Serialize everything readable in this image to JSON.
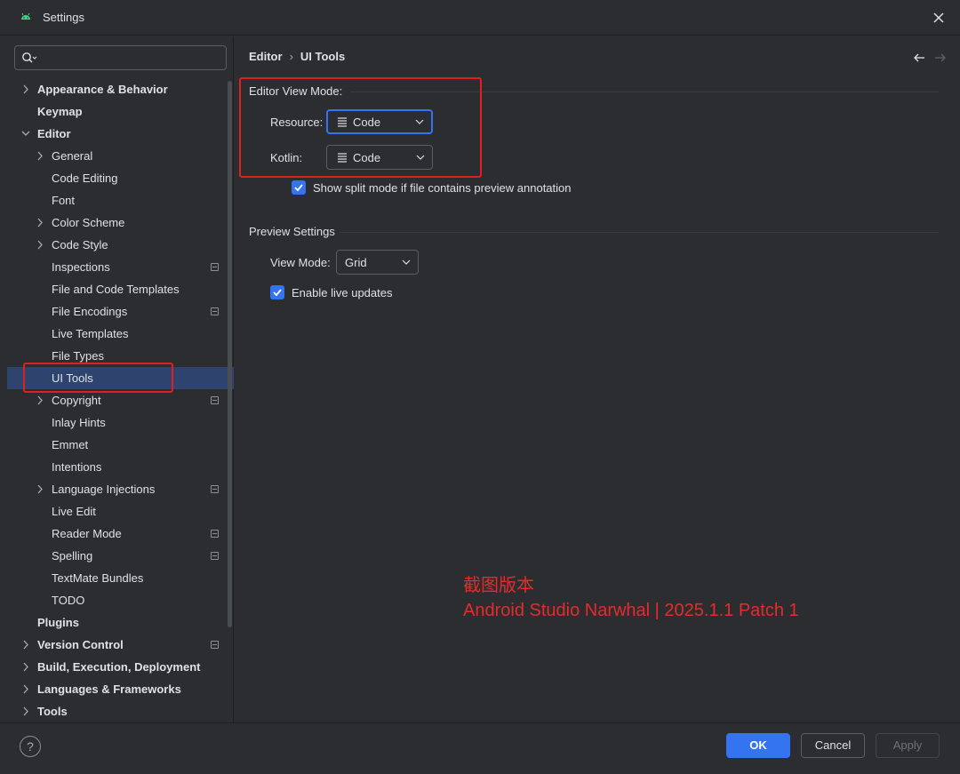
{
  "window": {
    "title": "Settings"
  },
  "search": {
    "placeholder": ""
  },
  "sidebar": {
    "items": [
      {
        "label": "Appearance & Behavior",
        "level": 0,
        "bold": true,
        "expandable": true,
        "expanded": false,
        "project": false
      },
      {
        "label": "Keymap",
        "level": 0,
        "bold": true,
        "expandable": false,
        "project": false
      },
      {
        "label": "Editor",
        "level": 0,
        "bold": true,
        "expandable": true,
        "expanded": true,
        "project": false
      },
      {
        "label": "General",
        "level": 1,
        "expandable": true,
        "expanded": false,
        "project": false
      },
      {
        "label": "Code Editing",
        "level": 1,
        "expandable": false,
        "project": false
      },
      {
        "label": "Font",
        "level": 1,
        "expandable": false,
        "project": false
      },
      {
        "label": "Color Scheme",
        "level": 1,
        "expandable": true,
        "expanded": false,
        "project": false
      },
      {
        "label": "Code Style",
        "level": 1,
        "expandable": true,
        "expanded": false,
        "project": false
      },
      {
        "label": "Inspections",
        "level": 1,
        "expandable": false,
        "project": true
      },
      {
        "label": "File and Code Templates",
        "level": 1,
        "expandable": false,
        "project": false
      },
      {
        "label": "File Encodings",
        "level": 1,
        "expandable": false,
        "project": true
      },
      {
        "label": "Live Templates",
        "level": 1,
        "expandable": false,
        "project": false
      },
      {
        "label": "File Types",
        "level": 1,
        "expandable": false,
        "project": false
      },
      {
        "label": "UI Tools",
        "level": 1,
        "expandable": false,
        "project": false,
        "selected": true
      },
      {
        "label": "Copyright",
        "level": 1,
        "expandable": true,
        "expanded": false,
        "project": true
      },
      {
        "label": "Inlay Hints",
        "level": 1,
        "expandable": false,
        "project": false
      },
      {
        "label": "Emmet",
        "level": 1,
        "expandable": false,
        "project": false
      },
      {
        "label": "Intentions",
        "level": 1,
        "expandable": false,
        "project": false
      },
      {
        "label": "Language Injections",
        "level": 1,
        "expandable": true,
        "expanded": false,
        "project": true
      },
      {
        "label": "Live Edit",
        "level": 1,
        "expandable": false,
        "project": false
      },
      {
        "label": "Reader Mode",
        "level": 1,
        "expandable": false,
        "project": true
      },
      {
        "label": "Spelling",
        "level": 1,
        "expandable": false,
        "project": true
      },
      {
        "label": "TextMate Bundles",
        "level": 1,
        "expandable": false,
        "project": false
      },
      {
        "label": "TODO",
        "level": 1,
        "expandable": false,
        "project": false
      },
      {
        "label": "Plugins",
        "level": 0,
        "bold": true,
        "expandable": false,
        "project": false
      },
      {
        "label": "Version Control",
        "level": 0,
        "bold": true,
        "expandable": true,
        "expanded": false,
        "project": true
      },
      {
        "label": "Build, Execution, Deployment",
        "level": 0,
        "bold": true,
        "expandable": true,
        "expanded": false,
        "project": false
      },
      {
        "label": "Languages & Frameworks",
        "level": 0,
        "bold": true,
        "expandable": true,
        "expanded": false,
        "project": false
      },
      {
        "label": "Tools",
        "level": 0,
        "bold": true,
        "expandable": true,
        "expanded": false,
        "project": false
      }
    ]
  },
  "content": {
    "breadcrumb": {
      "parent": "Editor",
      "separator": "›",
      "current": "UI Tools"
    },
    "editor_view_mode": {
      "title": "Editor View Mode:",
      "resource": {
        "label": "Resource:",
        "value": "Code"
      },
      "kotlin": {
        "label": "Kotlin:",
        "value": "Code"
      },
      "split_mode": {
        "label": "Show split mode if file contains preview annotation",
        "checked": true
      }
    },
    "preview_settings": {
      "title": "Preview Settings",
      "view_mode": {
        "label": "View Mode:",
        "value": "Grid"
      },
      "live_updates": {
        "label": "Enable live updates",
        "checked": true
      }
    }
  },
  "annotation": {
    "line1": "截图版本",
    "line2": "Android Studio Narwhal | 2025.1.1 Patch 1",
    "color": "#e62b2b"
  },
  "footer": {
    "help": "?",
    "ok": "OK",
    "cancel": "Cancel",
    "apply": "Apply"
  },
  "colors": {
    "background": "#2b2d30",
    "accent": "#3574f0",
    "selection": "#2e436e",
    "text": "#dfe1e5"
  }
}
